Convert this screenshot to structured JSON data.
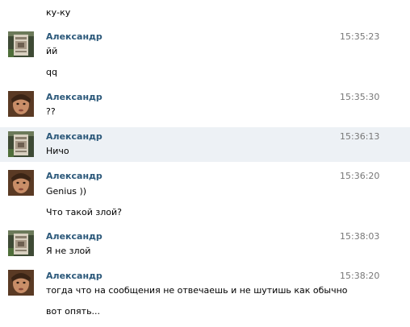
{
  "top_text": "ку-ку",
  "messages": [
    {
      "author": "Александр",
      "time": "15:35:23",
      "avatar": "doc-avatar-icon",
      "lines": [
        "йй",
        "qq"
      ]
    },
    {
      "author": "Александр",
      "time": "15:35:30",
      "avatar": "face-avatar-icon",
      "lines": [
        "??"
      ]
    },
    {
      "author": "Александр",
      "time": "15:36:13",
      "avatar": "doc-avatar-icon",
      "lines": [
        "Ничо"
      ]
    },
    {
      "author": "Александр",
      "time": "15:36:20",
      "avatar": "face-avatar-icon",
      "lines": [
        "Genius ))",
        "Что такой злой?"
      ]
    },
    {
      "author": "Александр",
      "time": "15:38:03",
      "avatar": "doc-avatar-icon",
      "lines": [
        "Я не злой"
      ]
    },
    {
      "author": "Александр",
      "time": "15:38:20",
      "avatar": "face-avatar-icon",
      "lines": [
        "тогда что на сообщения не отвечаешь и не шутишь как обычно",
        "вот опять..."
      ]
    }
  ],
  "colors": {
    "author": "#2b587a",
    "time": "#777777",
    "highlight_row": "#edf1f5"
  }
}
